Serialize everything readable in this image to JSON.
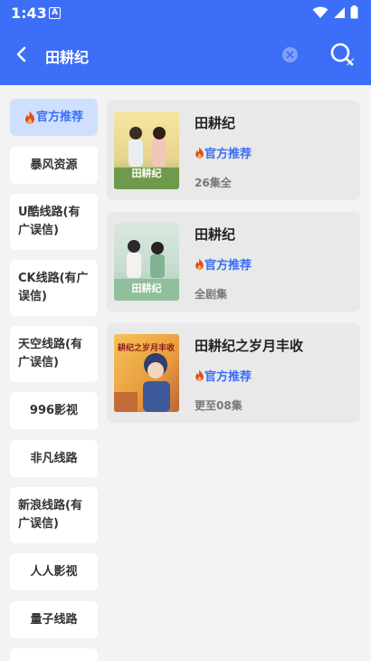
{
  "status": {
    "time": "1:43",
    "app_icon_letter": "A"
  },
  "search": {
    "query": "田耕纪"
  },
  "sidebar": {
    "items": [
      {
        "label": "官方推荐",
        "fire": true
      },
      {
        "label": "暴风资源"
      },
      {
        "label": "U酷线路(有广误信)"
      },
      {
        "label": "CK线路(有广误信)"
      },
      {
        "label": "天空线路(有广误信)"
      },
      {
        "label": "996影视"
      },
      {
        "label": "非凡线路"
      },
      {
        "label": "新浪线路(有广误信)"
      },
      {
        "label": "人人影视"
      },
      {
        "label": "量子线路"
      }
    ]
  },
  "results": [
    {
      "title": "田耕纪",
      "tag": "官方推荐",
      "episodes": "26集全",
      "poster_text": "田耕纪"
    },
    {
      "title": "田耕纪",
      "tag": "官方推荐",
      "episodes": "全剧集",
      "poster_text": "田耕纪"
    },
    {
      "title": "田耕纪之岁月丰收",
      "tag": "官方推荐",
      "episodes": "更至08集",
      "poster_text": "耕纪之岁月丰收"
    }
  ],
  "colors": {
    "header": "#3d6ef7",
    "accent": "#3a6ef5",
    "active_bg": "#cfe0ff",
    "fire": "#e64a19"
  },
  "icons": {
    "back": "chevron-left-icon",
    "clear": "close-icon",
    "search": "search-icon",
    "fire": "fire-icon"
  }
}
